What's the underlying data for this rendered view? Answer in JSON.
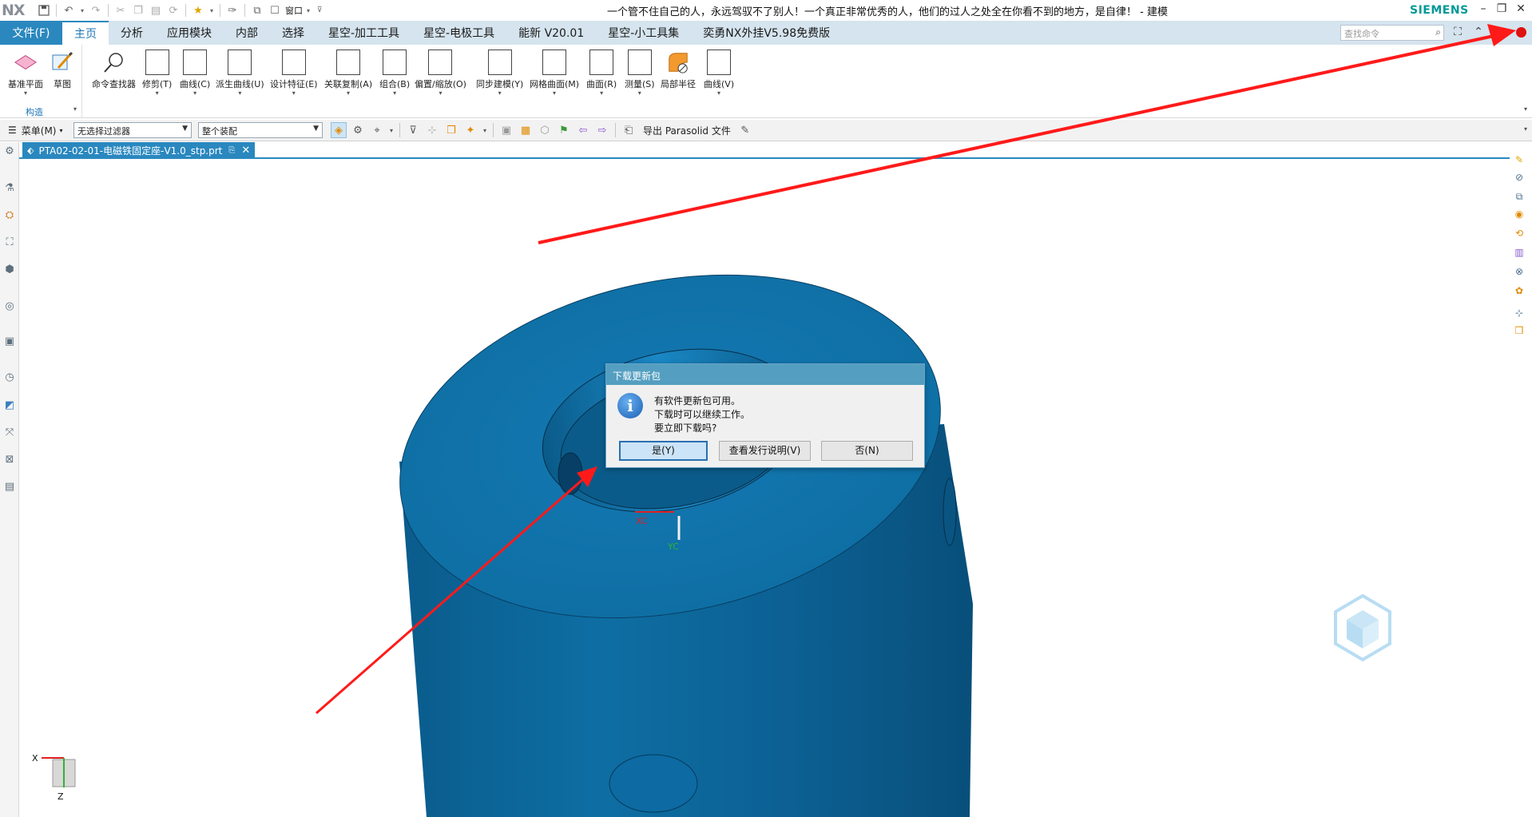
{
  "titlebar": {
    "logo": "NX",
    "title": "一个管不住自己的人，永远驾驭不了别人！一个真正非常优秀的人，他们的过人之处全在你看不到的地方，是自律！ - 建模",
    "brand": "SIEMENS",
    "window_menu_label": "窗口"
  },
  "tabs": {
    "file": "文件(F)",
    "items": [
      "主页",
      "分析",
      "应用模块",
      "内部",
      "选择",
      "星空-加工工具",
      "星空-电极工具",
      "能新 V20.01",
      "星空-小工具集",
      "奕勇NX外挂V5.98免费版"
    ],
    "active_index": 0
  },
  "search": {
    "placeholder": "查找命令"
  },
  "ribbon": {
    "construct_group": {
      "label": "构造",
      "datum_plane": "基准平面",
      "sketch": "草图"
    },
    "commands": [
      "命令查找器",
      "修剪(T)",
      "曲线(C)",
      "派生曲线(U)",
      "设计特征(E)",
      "关联复制(A)",
      "组合(B)",
      "偏置/缩放(O)",
      "同步建模(Y)",
      "网格曲面(M)",
      "曲面(R)",
      "测量(S)",
      "局部半径",
      "曲线(V)"
    ]
  },
  "selection_bar": {
    "menu_label": "菜单(M)",
    "filter_value": "无选择过滤器",
    "scope_value": "整个装配",
    "export_label": "导出 Parasolid 文件"
  },
  "document": {
    "tab_name": "PTA02-02-01-电磁铁固定座-V1.0_stp.prt"
  },
  "viewport": {
    "wcs_x_label": "XC",
    "wcs_y_label": "YC",
    "triad_x": "X",
    "triad_z": "Z",
    "part_color": "#0e6ea3"
  },
  "dialog": {
    "title": "下载更新包",
    "line1": "有软件更新包可用。",
    "line2": "下载时可以继续工作。",
    "line3": "要立即下载吗?",
    "yes": "是(Y)",
    "release_notes": "查看发行说明(V)",
    "no": "否(N)"
  },
  "colors": {
    "accent": "#2a88bf",
    "tab_bar": "#d5e4ee",
    "annotation": "#ff1a1a",
    "record_dot": "#e01010"
  }
}
